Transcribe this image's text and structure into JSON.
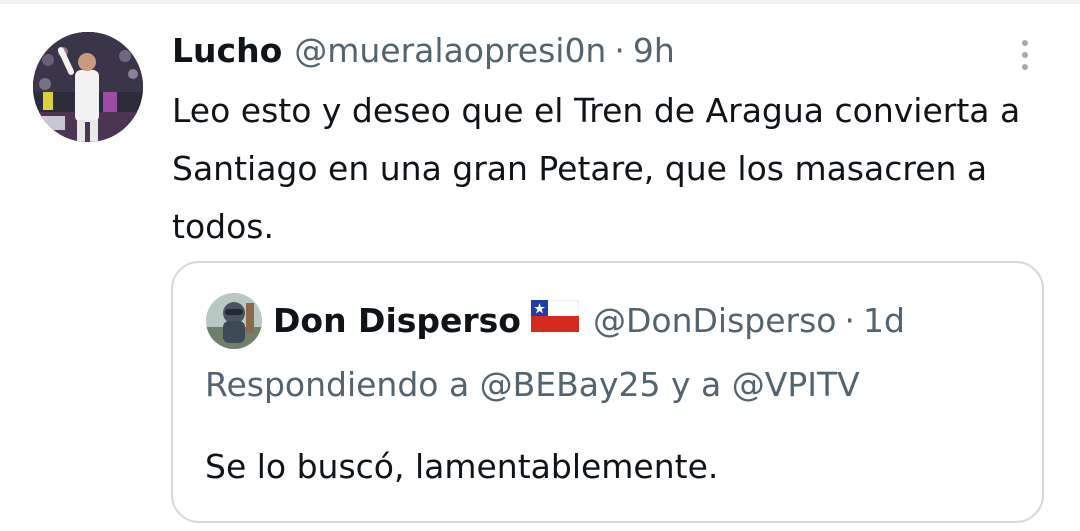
{
  "tweet": {
    "display_name": "Lucho",
    "handle": "@mueralaopresi0n",
    "separator": "·",
    "time": "9h",
    "text": "Leo esto y deseo que el Tren de Aragua convierta a Santiago en una gran Petare, que los masacren a todos.",
    "avatar_icon": "user-avatar-photo",
    "more_icon": "more-options-icon"
  },
  "quoted_tweet": {
    "display_name": "Don Disperso",
    "flag_icon": "chile-flag-emoji",
    "handle": "@DonDisperso",
    "separator": "·",
    "time": "1d",
    "replying_to": "Respondiendo a @BEBay25 y a @VPITV",
    "text": "Se lo buscó, lamentablemente.",
    "avatar_icon": "user-avatar-photo"
  },
  "colors": {
    "text_primary": "#0f1419",
    "text_secondary": "#536471",
    "border": "#cfd9de",
    "more_dots": "#a0aab2"
  }
}
